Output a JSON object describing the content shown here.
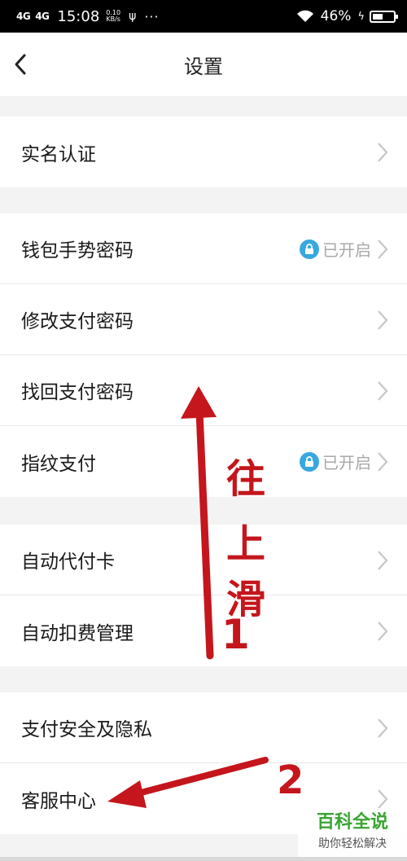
{
  "status_bar": {
    "signal1": "4G",
    "signal2": "4G",
    "time": "15:08",
    "net_speed_value": "0.10",
    "net_speed_unit": "KB/s",
    "usb_icon": "usb-icon",
    "more": "···",
    "battery_percent": "46%"
  },
  "nav": {
    "title": "设置"
  },
  "groups": {
    "g1": {
      "rows": [
        {
          "label": "实名认证"
        }
      ]
    },
    "g2": {
      "rows": [
        {
          "label": "钱包手势密码",
          "status": "已开启"
        },
        {
          "label": "修改支付密码"
        },
        {
          "label": "找回支付密码"
        },
        {
          "label": "指纹支付",
          "status": "已开启"
        }
      ]
    },
    "g3": {
      "rows": [
        {
          "label": "自动代付卡"
        },
        {
          "label": "自动扣费管理"
        }
      ]
    },
    "g4": {
      "rows": [
        {
          "label": "支付安全及隐私"
        },
        {
          "label": "客服中心"
        }
      ]
    }
  },
  "annotation": {
    "swipe_text_1": "往",
    "swipe_text_2": "上",
    "swipe_text_3": "滑",
    "step1": "1",
    "step2": "2",
    "color": "#c4161c"
  },
  "watermark": {
    "title": "百科全说",
    "subtitle": "助你轻松解决"
  },
  "colors": {
    "status_on": "#38a8e0",
    "chevron": "#c6c6c6"
  }
}
